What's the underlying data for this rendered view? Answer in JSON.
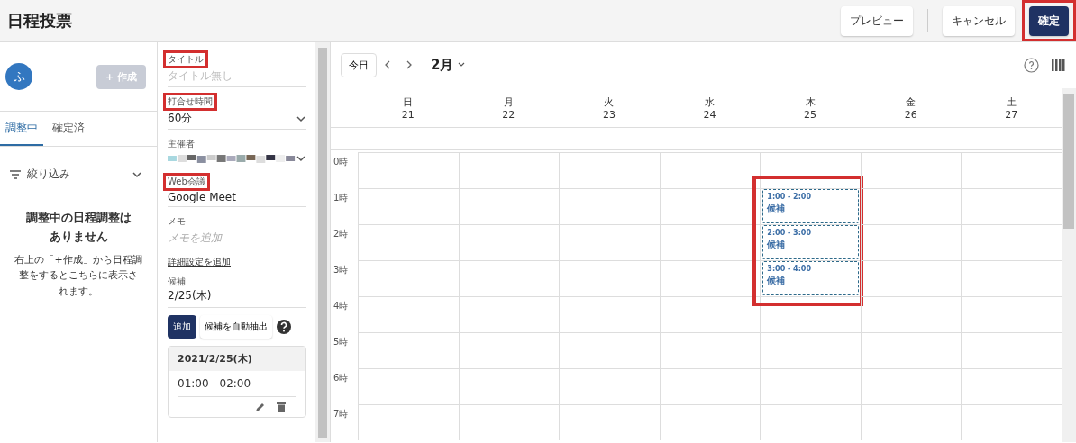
{
  "header": {
    "title": "日程投票",
    "buttons": [
      {
        "label": "プレビュー",
        "kind": "outline",
        "highlighted": false
      },
      {
        "label": "キャンセル",
        "kind": "outline",
        "highlighted": false
      },
      {
        "label": "確定",
        "kind": "primary",
        "highlighted": true
      }
    ]
  },
  "sidebar": {
    "avatar": "ふ",
    "create_button": {
      "label": "+ 作成",
      "disabled": true
    },
    "tabs": [
      {
        "label": "調整中",
        "selected": true
      },
      {
        "label": "確定済",
        "selected": false
      }
    ],
    "filter": "絞り込み",
    "empty_title": "調整中の日程調整はありません",
    "empty_message": "右上の「+作成」から日程調整をするとこちらに表示されます。"
  },
  "form": {
    "fields": [
      {
        "kind": "text",
        "label": "タイトル",
        "placeholder": "タイトル無し",
        "highlighted": true
      },
      {
        "kind": "select",
        "label": "打合せ時間",
        "value": "60分",
        "highlighted": true
      },
      {
        "kind": "redacted",
        "label": "主催者",
        "highlighted": false
      },
      {
        "kind": "value",
        "label": "Web会議",
        "value": "Google Meet",
        "highlighted": true
      },
      {
        "kind": "memo",
        "label": "メモ",
        "placeholder": "メモを追加",
        "highlighted": false
      }
    ],
    "advanced_link": "詳細設定を追加",
    "candidates_label": "候補",
    "candidates_value": "2/25(木)",
    "add_button": "追加",
    "auto_button": "候補を自動抽出",
    "card": {
      "date": "2021/2/25(木)",
      "slots": [
        "01:00 - 02:00"
      ]
    }
  },
  "calendar": {
    "today_button": "今日",
    "month": "2月",
    "days": [
      {
        "weekday": "日",
        "date": "21"
      },
      {
        "weekday": "月",
        "date": "22"
      },
      {
        "weekday": "火",
        "date": "23"
      },
      {
        "weekday": "水",
        "date": "24"
      },
      {
        "weekday": "木",
        "date": "25"
      },
      {
        "weekday": "金",
        "date": "26"
      },
      {
        "weekday": "土",
        "date": "27"
      }
    ],
    "events_highlighted": true,
    "rows": [
      {
        "hour": "0時"
      },
      {
        "hour": "1時",
        "cells": [
          null,
          null,
          null,
          null,
          {
            "time": "1:00 - 2:00",
            "label": "候補"
          },
          null,
          null
        ]
      },
      {
        "hour": "2時",
        "cells": [
          null,
          null,
          null,
          null,
          {
            "time": "2:00 - 3:00",
            "label": "候補"
          },
          null,
          null
        ]
      },
      {
        "hour": "3時",
        "cells": [
          null,
          null,
          null,
          null,
          {
            "time": "3:00 - 4:00",
            "label": "候補"
          },
          null,
          null
        ]
      },
      {
        "hour": "4時"
      },
      {
        "hour": "5時"
      },
      {
        "hour": "6時"
      },
      {
        "hour": "7時"
      }
    ]
  }
}
